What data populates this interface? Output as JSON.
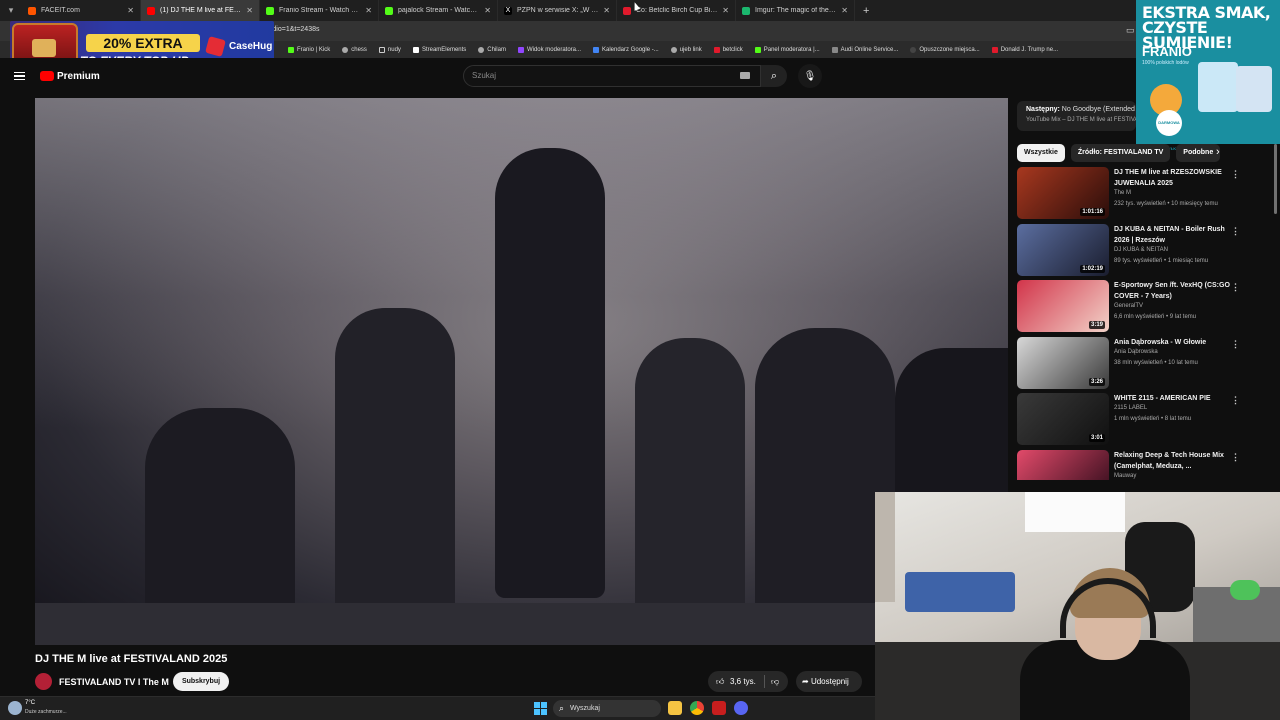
{
  "tabs": [
    {
      "title": "FACEIT.com",
      "color": "#ff5500"
    },
    {
      "title": "(1) DJ THE M live at FESTIVALAND",
      "color": "#ff0000",
      "active": true
    },
    {
      "title": "Franio Stream - Watch Live on Kick",
      "color": "#53fc18"
    },
    {
      "title": "pajalock Stream - Watch Live on Kick",
      "color": "#53fc18"
    },
    {
      "title": "PZPN w serwisie X: „W związku",
      "color": "#000000"
    },
    {
      "title": "Co: Betclic Birch Cup Bitwa Stre",
      "color": "#e11a2c"
    },
    {
      "title": "Imgur: The magic of the Internet",
      "color": "#1bb76e"
    }
  ],
  "address": {
    "url": "rt_radio=1&t=2438s"
  },
  "bookmarks": [
    {
      "label": "Franio | Kick",
      "color": "#53fc18"
    },
    {
      "label": "chess",
      "color": "#aaaaaa"
    },
    {
      "label": "nudy",
      "color": "#aaaaaa"
    },
    {
      "label": "StreamElements",
      "color": "#ffffff"
    },
    {
      "label": "Chilam",
      "color": "#aaaaaa"
    },
    {
      "label": "Widok moderatora...",
      "color": "#9146ff"
    },
    {
      "label": "Kalendarz Google -...",
      "color": "#4285f4"
    },
    {
      "label": "ujeb link",
      "color": "#aaaaaa"
    },
    {
      "label": "betclick",
      "color": "#e11a2c"
    },
    {
      "label": "Panel moderatora |...",
      "color": "#53fc18"
    },
    {
      "label": "Audi Online Service...",
      "color": "#888888"
    },
    {
      "label": "Opuszczone miejsca...",
      "color": "#444444"
    },
    {
      "label": "Donald J. Trump ne...",
      "color": "#e11a2c"
    }
  ],
  "ad_left": {
    "headline": "20% EXTRA",
    "subline": "TO EVERY TOP-UP",
    "brand": "CaseHug"
  },
  "ad_right": {
    "headline": "EKSTRA SMAK, CZYSTE SUMIENIE!",
    "brand": "FRANIO",
    "tag": "100% polskich lodów",
    "stamp": "DARMOWA WYSYŁKA"
  },
  "header": {
    "brand": "Premium",
    "search_placeholder": "Szukaj"
  },
  "video": {
    "title": "DJ THE M live at FESTIVALAND 2025",
    "channel": "FESTIVALAND TV I The M",
    "subscribe": "Subskrybuj",
    "likes": "3,6 tys.",
    "share": "Udostępnij"
  },
  "sidebar": {
    "next_label": "Następny:",
    "next_title": "No Goodbye (Extended",
    "next_sub": "YouTube Mix – DJ THE M live at FESTIVA",
    "chips": [
      "Wszystkie",
      "Źródło: FESTIVALAND TV",
      "Podobne"
    ],
    "recommendations": [
      {
        "title": "DJ THE M live at RZESZOWSKIE JUWENALIA 2025",
        "channel": "The M",
        "meta": "232 tys. wyświetleń • 10 miesięcy temu",
        "duration": "1:01:16",
        "c1": "#a8381f",
        "c2": "#2a0d0a"
      },
      {
        "title": "DJ KUBA & NEITAN - Boiler Rush 2026 | Rzeszów",
        "channel": "DJ KUBA & NEITAN",
        "meta": "89 tys. wyświetleń • 1 miesiąc temu",
        "duration": "1:02:19",
        "c1": "#5b6ea0",
        "c2": "#1a1d2e"
      },
      {
        "title": "E-Sportowy Sen /ft. VexHQ (CS:GO COVER - 7 Years)",
        "channel": "GeneralTV",
        "meta": "6,6 mln wyświetleń • 9 lat temu",
        "duration": "3:19",
        "c1": "#d2344a",
        "c2": "#f2d2c8"
      },
      {
        "title": "Ania Dąbrowska - W Głowie",
        "channel": "Ania Dąbrowska",
        "meta": "38 mln wyświetleń • 10 lat temu",
        "duration": "3:26",
        "c1": "#d8d8d8",
        "c2": "#3a3a3a"
      },
      {
        "title": "WHITE 2115 - AMERICAN PIE",
        "channel": "2115 LABEL",
        "meta": "1 mln wyświetleń • 8 lat temu",
        "duration": "3:01",
        "c1": "#3a3a3a",
        "c2": "#101010"
      },
      {
        "title": "Relaxing Deep & Tech House Mix (Camelphat, Meduza, ...",
        "channel": "Mauway",
        "meta": "5,1 mln wyświetleń • 6 lat temu",
        "duration": "",
        "c1": "#e24a6a",
        "c2": "#2a0a18"
      }
    ]
  },
  "taskbar": {
    "temp": "7°C",
    "weather": "Duże zachmurze...",
    "search": "Wyszukaj"
  }
}
